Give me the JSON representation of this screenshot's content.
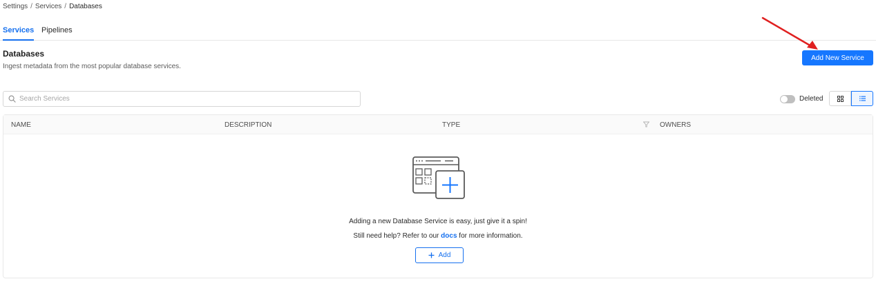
{
  "breadcrumb": [
    "Settings",
    "Services",
    "Databases"
  ],
  "tabs": [
    {
      "label": "Services",
      "active": true
    },
    {
      "label": "Pipelines",
      "active": false
    }
  ],
  "page": {
    "title": "Databases",
    "subtitle": "Ingest metadata from the most popular database services."
  },
  "actions": {
    "add_new_service": "Add New Service"
  },
  "search": {
    "placeholder": "Search Services",
    "value": ""
  },
  "filters": {
    "deleted_label": "Deleted",
    "deleted_on": false
  },
  "view_toggle": {
    "selected": "list",
    "options": [
      "grid-icon",
      "list-icon"
    ]
  },
  "table": {
    "columns": [
      "NAME",
      "DESCRIPTION",
      "TYPE",
      "OWNERS"
    ],
    "rows": []
  },
  "empty_state": {
    "line1": "Adding a new Database Service is easy, just give it a spin!",
    "line2_prefix": "Still need help? Refer to our",
    "link": "docs",
    "line2_suffix": "for more information.",
    "add_label": "Add"
  },
  "colors": {
    "accent": "#1677ff",
    "link": "#1570ef",
    "annotation": "#e02020"
  }
}
